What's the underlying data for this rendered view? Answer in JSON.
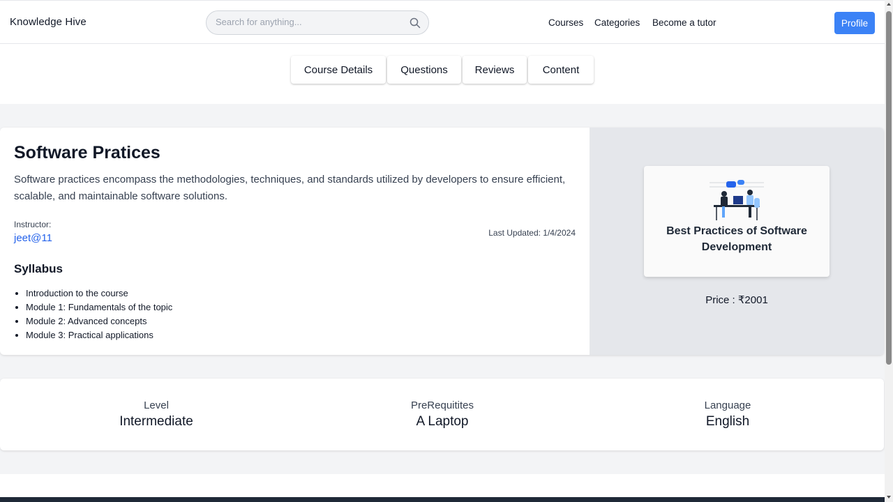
{
  "header": {
    "brand": "Knowledge Hive",
    "search_placeholder": "Search for anything...",
    "nav": [
      "Courses",
      "Categories",
      "Become a tutor"
    ],
    "profile_label": "Profile"
  },
  "tabs": [
    "Course Details",
    "Questions",
    "Reviews",
    "Content"
  ],
  "course": {
    "title": "Software Pratices",
    "description": "Software practices encompass the methodologies, techniques, and standards utilized by developers to ensure efficient, scalable, and maintainable software solutions.",
    "instructor_label": "Instructor:",
    "instructor": "jeet@11",
    "last_updated": "Last Updated: 1/4/2024",
    "syllabus_title": "Syllabus",
    "syllabus": [
      "Introduction to the course",
      "Module 1: Fundamentals of the topic",
      "Module 2: Advanced concepts",
      "Module 3: Practical applications"
    ],
    "thumbnail_line1": "Best Practices of Software",
    "thumbnail_line2": "Development",
    "price": "Price : ₹2001"
  },
  "meta": {
    "level_label": "Level",
    "level": "Intermediate",
    "prereq_label": "PreRequitites",
    "prereq": "A Laptop",
    "language_label": "Language",
    "language": "English"
  },
  "colors": {
    "accent": "#3b82f6",
    "link": "#2563eb",
    "page_bg": "#f3f4f6",
    "panel_bg": "#e5e7eb",
    "footer": "#1f2937"
  }
}
